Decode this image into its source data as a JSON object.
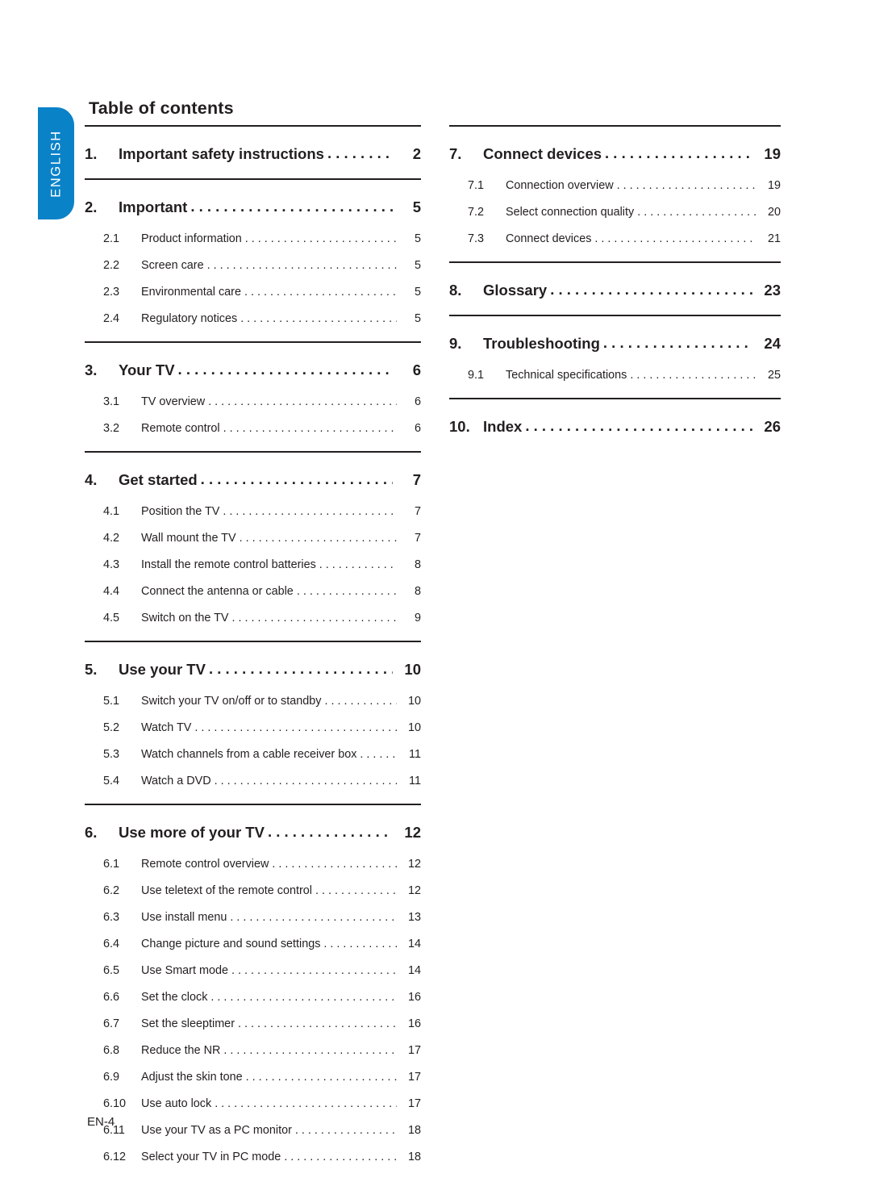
{
  "language_tab": {
    "label": "ENGLISH",
    "color": "#0a82c8"
  },
  "page": {
    "title": "Table of contents",
    "footer": "EN-4",
    "text_color": "#231f20"
  },
  "toc": {
    "left_column": [
      {
        "number": "1.",
        "label": "Important safety instructions",
        "page": "2",
        "children": []
      },
      {
        "number": "2.",
        "label": "Important",
        "page": "5",
        "children": [
          {
            "number": "2.1",
            "label": "Product information",
            "page": "5"
          },
          {
            "number": "2.2",
            "label": "Screen care",
            "page": "5"
          },
          {
            "number": "2.3",
            "label": "Environmental care",
            "page": "5"
          },
          {
            "number": "2.4",
            "label": "Regulatory notices",
            "page": "5"
          }
        ]
      },
      {
        "number": "3.",
        "label": "Your TV",
        "page": "6",
        "children": [
          {
            "number": "3.1",
            "label": "TV overview",
            "page": "6"
          },
          {
            "number": "3.2",
            "label": "Remote control",
            "page": "6"
          }
        ]
      },
      {
        "number": "4.",
        "label": "Get started",
        "page": "7",
        "children": [
          {
            "number": "4.1",
            "label": "Position the TV",
            "page": "7"
          },
          {
            "number": "4.2",
            "label": "Wall mount the TV",
            "page": "7"
          },
          {
            "number": "4.3",
            "label": "Install the remote control batteries",
            "page": "8"
          },
          {
            "number": "4.4",
            "label": "Connect the antenna or cable",
            "page": "8"
          },
          {
            "number": "4.5",
            "label": "Switch on the TV",
            "page": "9"
          }
        ]
      },
      {
        "number": "5.",
        "label": "Use your TV",
        "page": "10",
        "children": [
          {
            "number": "5.1",
            "label": "Switch your TV on/off or to standby",
            "page": "10"
          },
          {
            "number": "5.2",
            "label": "Watch TV",
            "page": "10"
          },
          {
            "number": "5.3",
            "label": "Watch channels from a cable receiver box",
            "page": "11"
          },
          {
            "number": "5.4",
            "label": "Watch a DVD",
            "page": "11"
          }
        ]
      },
      {
        "number": "6.",
        "label": "Use more of your TV",
        "page": "12",
        "children": [
          {
            "number": "6.1",
            "label": "Remote control overview",
            "page": "12"
          },
          {
            "number": "6.2",
            "label": "Use teletext of the remote control",
            "page": "12"
          },
          {
            "number": "6.3",
            "label": "Use install menu",
            "page": "13"
          },
          {
            "number": "6.4",
            "label": "Change picture and sound settings",
            "page": "14"
          },
          {
            "number": "6.5",
            "label": "Use Smart mode",
            "page": "14"
          },
          {
            "number": "6.6",
            "label": "Set the clock",
            "page": "16"
          },
          {
            "number": "6.7",
            "label": "Set the sleeptimer",
            "page": "16"
          },
          {
            "number": "6.8",
            "label": "Reduce the NR",
            "page": "17"
          },
          {
            "number": "6.9",
            "label": "Adjust the skin tone",
            "page": "17"
          },
          {
            "number": "6.10",
            "label": "Use auto lock",
            "page": "17"
          },
          {
            "number": "6.11",
            "label": "Use your TV as a PC monitor",
            "page": "18"
          },
          {
            "number": "6.12",
            "label": "Select your TV in PC mode",
            "page": "18"
          }
        ]
      }
    ],
    "right_column": [
      {
        "number": "7.",
        "label": "Connect devices",
        "page": "19",
        "children": [
          {
            "number": "7.1",
            "label": "Connection overview",
            "page": "19"
          },
          {
            "number": "7.2",
            "label": "Select connection quality",
            "page": "20"
          },
          {
            "number": "7.3",
            "label": "Connect devices",
            "page": "21"
          }
        ]
      },
      {
        "number": "8.",
        "label": "Glossary",
        "page": "23",
        "children": []
      },
      {
        "number": "9.",
        "label": "Troubleshooting",
        "page": "24",
        "children": [
          {
            "number": "9.1",
            "label": "Technical specifications",
            "page": "25"
          }
        ]
      },
      {
        "number": "10.",
        "label": "Index",
        "page": "26",
        "children": []
      }
    ]
  }
}
